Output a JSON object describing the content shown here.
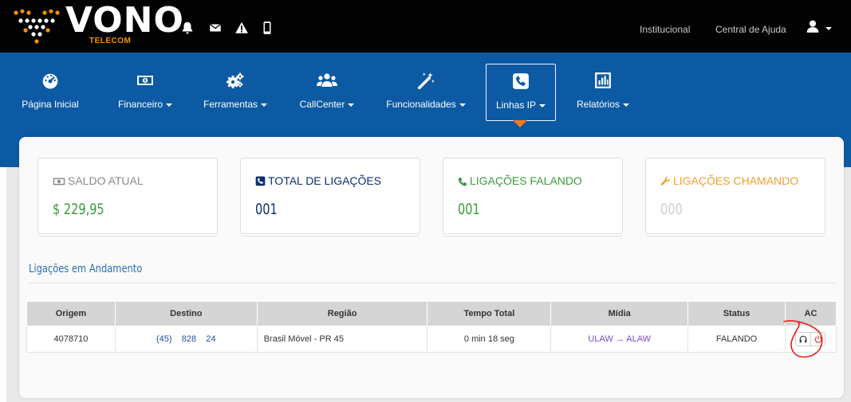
{
  "brand": {
    "wordmark": "VONO",
    "sub": "TELECOM",
    "colors": {
      "topbar": "#020202",
      "nav": "#0c5aa3",
      "accent": "#f39200",
      "active_arrow": "#f47c20"
    }
  },
  "topbar": {
    "icons": [
      "bell-icon",
      "envelope-icon",
      "warning-icon",
      "mobile-icon"
    ],
    "links": [
      "Institucional",
      "Central de Ajuda"
    ],
    "user_icon": "user-icon"
  },
  "nav": {
    "items": [
      {
        "label": "Página Inicial",
        "icon": "dashboard-icon",
        "dropdown": false
      },
      {
        "label": "Financeiro",
        "icon": "money-icon",
        "dropdown": true
      },
      {
        "label": "Ferramentas",
        "icon": "gears-icon",
        "dropdown": true
      },
      {
        "label": "CallCenter",
        "icon": "users-icon",
        "dropdown": true
      },
      {
        "label": "Funcionalidades",
        "icon": "magic-wand-icon",
        "dropdown": true
      },
      {
        "label": "Linhas IP",
        "icon": "phone-square-icon",
        "dropdown": true,
        "active": true
      },
      {
        "label": "Relatórios",
        "icon": "bar-chart-icon",
        "dropdown": true
      }
    ]
  },
  "cards": [
    {
      "title": "SALDO ATUAL",
      "value": "$ 229,95",
      "icon": "money-icon",
      "title_color": "#8a8a8a",
      "value_color": "#3c9a3c"
    },
    {
      "title": "TOTAL DE LIGAÇÕES",
      "value": "001",
      "icon": "phone-square-icon",
      "title_color": "#0d2f6b",
      "value_color": "#0d2f6b"
    },
    {
      "title": "LIGAÇÕES FALANDO",
      "value": "001",
      "icon": "phone-icon",
      "title_color": "#3c9a3c",
      "value_color": "#3c9a3c"
    },
    {
      "title": "LIGAÇÕES CHAMANDO",
      "value": "000",
      "icon": "wrench-icon",
      "title_color": "#f0a030",
      "value_color": "#cfcfcf"
    }
  ],
  "section": {
    "title": "Ligações em Andamento"
  },
  "table": {
    "columns": [
      "Origem",
      "Destino",
      "Região",
      "Tempo Total",
      "Mídia",
      "Status",
      "AC"
    ],
    "rows": [
      {
        "origem": "4078710",
        "destino_ddd": "(45)",
        "destino_a": "828",
        "destino_b": "24",
        "regiao": "Brasil Móvel - PR 45",
        "tempo_total": "0 min 18 seg",
        "midia_from": "ULAW",
        "midia_arrow": "→",
        "midia_to": "ALAW",
        "status": "FALANDO",
        "actions": [
          "headphones-icon",
          "power-icon"
        ]
      }
    ]
  }
}
